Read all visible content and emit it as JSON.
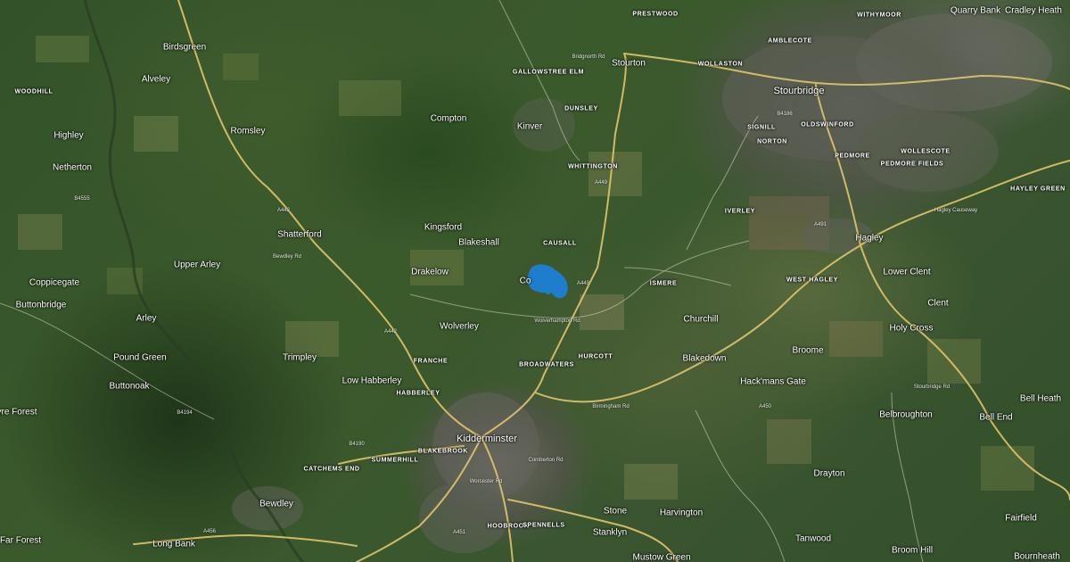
{
  "map": {
    "style": "satellite",
    "colors": {
      "road": "#e2c46a",
      "water_pin": "#1e7fd6",
      "label": "#ffffff",
      "urban": "#5e6057"
    }
  },
  "places": {
    "woodhill": "WOODHILL",
    "alveley": "Alveley",
    "birdsgreen": "Birdsgreen",
    "highley": "Highley",
    "romsley": "Romsley",
    "netherton": "Netherton",
    "shatterford": "Shatterford",
    "upper_arley": "Upper Arley",
    "coppicegate": "Coppicegate",
    "buttonbridge": "Buttonbridge",
    "arley": "Arley",
    "pound_green": "Pound Green",
    "trimpley": "Trimpley",
    "buttonoak": "Buttonoak",
    "wyre_forest": "yre Forest",
    "far_forest": "Far Forest",
    "bewdley": "Bewdley",
    "long_bank": "Long Bank",
    "catchems_end": "CATCHEMS END",
    "summerhill": "SUMMERHILL",
    "blakebrook": "BLAKEBROOK",
    "low_habberley": "Low Habberley",
    "habberley": "HABBERLEY",
    "franche": "FRANCHE",
    "wolverley": "Wolverley",
    "drakelow": "Drakelow",
    "kingsford": "Kingsford",
    "blakeshall": "Blakeshall",
    "compton": "Compton",
    "gallowstree_elm": "GALLOWSTREE ELM",
    "kinver": "Kinver",
    "dunsley": "DUNSLEY",
    "whittington": "WHITTINGTON",
    "stourton": "Stourton",
    "prestwood": "PRESTWOOD",
    "wollaston": "WOLLASTON",
    "stourbridge": "Stourbridge",
    "amblecote": "AMBLECOTE",
    "withymoor": "WITHYMOOR",
    "quarry_bank": "Quarry Bank",
    "cradley_heath": "Cradley Heath",
    "signill": "SIGNILL",
    "norton": "NORTON",
    "oldswinford": "OLDSWINFORD",
    "pedmore": "PEDMORE",
    "wollescote": "WOLLESCOTE",
    "pedmore_fields": "PEDMORE FIELDS",
    "hayley_green": "HAYLEY GREEN",
    "iverley": "IVERLEY",
    "causall": "CAUSALL",
    "cookley": "Co",
    "ismere": "ISMERE",
    "hagley": "Hagley",
    "west_hagley": "WEST HAGLEY",
    "lower_clent": "Lower Clent",
    "clent": "Clent",
    "holy_cross": "Holy Cross",
    "churchill": "Churchill",
    "broome": "Broome",
    "hurcott": "HURCOTT",
    "broadwaters": "BROADWATERS",
    "blakedown": "Blakedown",
    "hackmans_gate": "Hack'mans Gate",
    "belbroughton": "Belbroughton",
    "bell_heath": "Bell Heath",
    "bell_end": "Bell End",
    "kidderminster": "Kidderminster",
    "drayton": "Drayton",
    "harvington": "Harvington",
    "stone": "Stone",
    "stanklyn": "Stanklyn",
    "hoobrook": "HOOBROOK",
    "spennells": "SPENNELLS",
    "mustow_green": "Mustow Green",
    "tanwood": "Tanwood",
    "broom_hill": "Broom Hill",
    "fairfield": "Fairfield",
    "bournheath": "Bournheath"
  },
  "roads": {
    "a442_a": "A442",
    "a442_b": "A442",
    "b4194": "B4194",
    "b4555": "B4555",
    "b4190": "B4190",
    "a456": "A456",
    "a449_a": "A449",
    "a449_b": "A449",
    "a451": "A451",
    "a491": "A491",
    "a450": "A450",
    "b4186": "B4186",
    "birmingham_rd": "Birmingham Rd",
    "bridgnorth_rd": "Bridgnorth Rd",
    "hagley_causeway": "Hagley Causeway",
    "stourbridge_rd": "Stourbridge Rd",
    "bewdley_rd": "Bewdley Rd",
    "wolverhampton_rd": "Wolverhampton Rd",
    "comberton_rd": "Comberton Rd",
    "worcester_rd": "Worcester Rd"
  },
  "marker": {
    "name": "water-region-marker"
  }
}
